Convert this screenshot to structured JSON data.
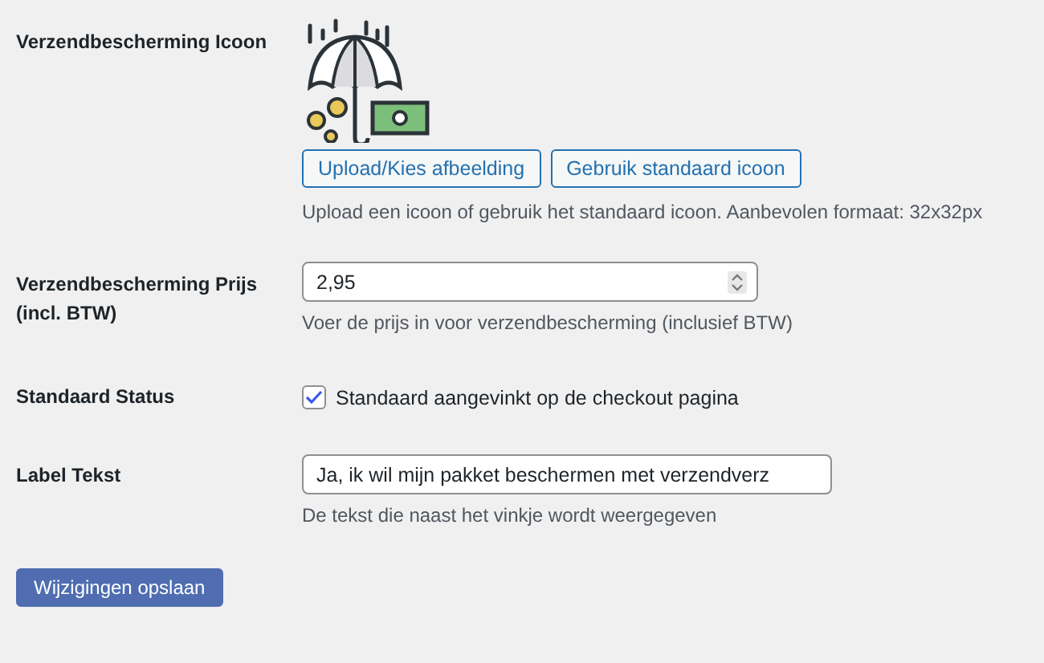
{
  "icon_setting": {
    "label": "Verzendbescherming Icoon",
    "buttons": [
      "Upload/Kies afbeelding",
      "Gebruik standaard icoon"
    ],
    "description": "Upload een icoon of gebruik het standaard icoon. Aanbevolen formaat: 32x32px"
  },
  "price_setting": {
    "label": "Verzendbescherming Prijs (incl. BTW)",
    "value": "2,95",
    "description": "Voer de prijs in voor verzendbescherming (inclusief BTW)"
  },
  "status_setting": {
    "label": "Standaard Status",
    "checked": true,
    "checkbox_label": "Standaard aangevinkt op de checkout pagina"
  },
  "label_setting": {
    "label": "Label Tekst",
    "value": "Ja, ik wil mijn pakket beschermen met verzendverz",
    "description": "De tekst die naast het vinkje wordt weergegeven"
  },
  "save_button": "Wijzigingen opslaan"
}
